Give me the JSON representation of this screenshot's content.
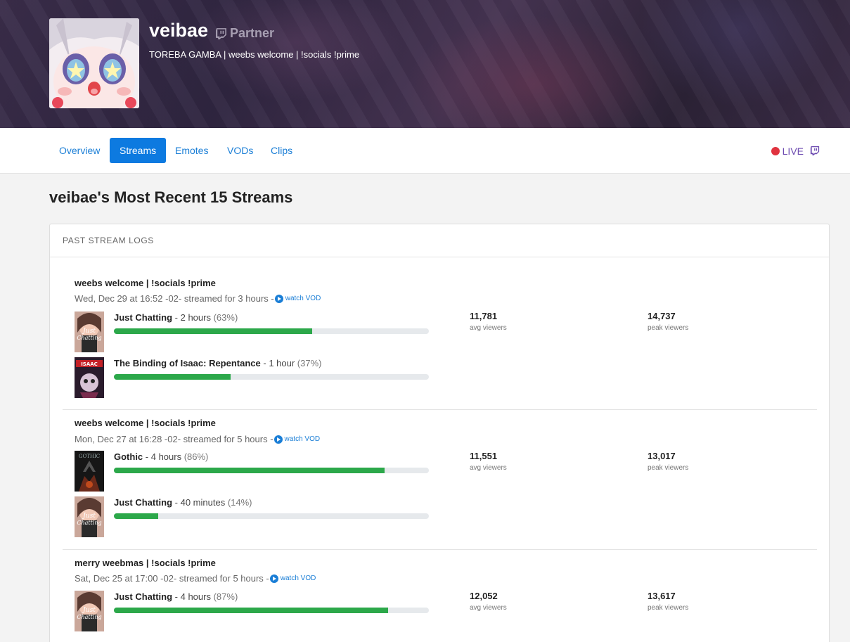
{
  "header": {
    "channel_name": "veibae",
    "partner_label": "Partner",
    "stream_title": "TOREBA GAMBA | weebs welcome | !socials !prime"
  },
  "nav": {
    "tabs": [
      {
        "label": "Overview",
        "active": false
      },
      {
        "label": "Streams",
        "active": true
      },
      {
        "label": "Emotes",
        "active": false
      },
      {
        "label": "VODs",
        "active": false
      },
      {
        "label": "Clips",
        "active": false
      }
    ],
    "live_label": "LIVE"
  },
  "page_heading": "veibae's Most Recent 15 Streams",
  "card_title": "PAST STREAM LOGS",
  "streams": [
    {
      "title": "weebs welcome | !socials !prime",
      "meta": "Wed, Dec 29 at 16:52 -02- streamed for 3 hours -",
      "vod_label": "watch VOD",
      "avg_viewers": "11,781",
      "avg_label": "avg viewers",
      "peak_viewers": "14,737",
      "peak_label": "peak viewers",
      "games": [
        {
          "name": "Just Chatting",
          "duration": " - 2 hours ",
          "percent_text": "(63%)",
          "fraction": 0.63,
          "thumb_icon": "just-chatting-thumb"
        },
        {
          "name": "The Binding of Isaac: Repentance",
          "duration": " - 1 hour ",
          "percent_text": "(37%)",
          "fraction": 0.37,
          "thumb_icon": "isaac-thumb"
        }
      ]
    },
    {
      "title": "weebs welcome | !socials !prime",
      "meta": "Mon, Dec 27 at 16:28 -02- streamed for 5 hours -",
      "vod_label": "watch VOD",
      "avg_viewers": "11,551",
      "avg_label": "avg viewers",
      "peak_viewers": "13,017",
      "peak_label": "peak viewers",
      "games": [
        {
          "name": "Gothic",
          "duration": " - 4 hours ",
          "percent_text": "(86%)",
          "fraction": 0.86,
          "thumb_icon": "gothic-thumb"
        },
        {
          "name": "Just Chatting",
          "duration": " - 40 minutes ",
          "percent_text": "(14%)",
          "fraction": 0.14,
          "thumb_icon": "just-chatting-thumb"
        }
      ]
    },
    {
      "title": "merry weebmas | !socials !prime",
      "meta": "Sat, Dec 25 at 17:00 -02- streamed for 5 hours -",
      "vod_label": "watch VOD",
      "avg_viewers": "12,052",
      "avg_label": "avg viewers",
      "peak_viewers": "13,617",
      "peak_label": "peak viewers",
      "games": [
        {
          "name": "Just Chatting",
          "duration": " - 4 hours ",
          "percent_text": "(87%)",
          "fraction": 0.87,
          "thumb_icon": "just-chatting-thumb"
        }
      ]
    }
  ],
  "colors": {
    "accent": "#0d7ae0",
    "bar_fill": "#2ca84a",
    "live_dot": "#e0333f"
  }
}
